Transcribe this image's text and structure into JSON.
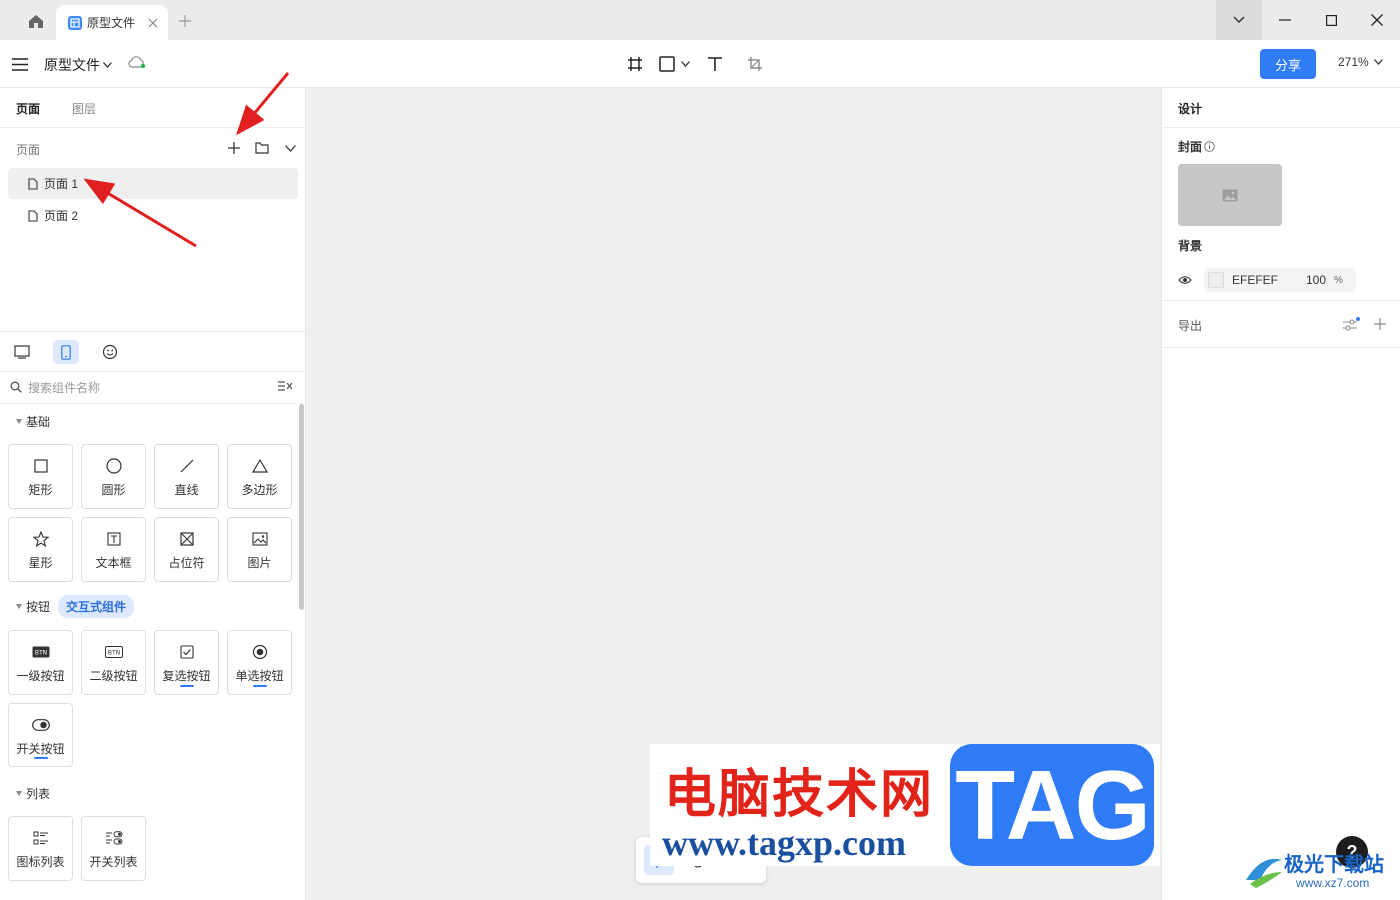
{
  "titlebar": {
    "tab_label": "原型文件"
  },
  "toolbar": {
    "filename": "原型文件",
    "share_label": "分享",
    "zoom": "271%"
  },
  "left_panel": {
    "tabs": [
      "页面",
      "图层"
    ],
    "pages_heading": "页面",
    "pages": [
      "页面 1",
      "页面 2"
    ],
    "selected_page": 0,
    "search_placeholder": "搜索组件名称",
    "sections": {
      "basic": {
        "title": "基础",
        "items": [
          "矩形",
          "圆形",
          "直线",
          "多边形",
          "星形",
          "文本框",
          "占位符",
          "图片"
        ]
      },
      "buttons": {
        "title": "按钮",
        "badge": "交互式组件",
        "items": [
          "一级按钮",
          "二级按钮",
          "复选按钮",
          "单选按钮",
          "开关按钮"
        ]
      },
      "lists": {
        "title": "列表",
        "items": [
          "图标列表",
          "开关列表"
        ]
      }
    }
  },
  "right_panel": {
    "title": "设计",
    "cover_label": "封面",
    "background_label": "背景",
    "background_hex": "EFEFEF",
    "background_opacity": "100",
    "background_opacity_unit": "%",
    "export_label": "导出"
  },
  "watermark": {
    "cn": "电脑技术网",
    "url": "www.tagxp.com",
    "tag": "TAG",
    "site2_title": "极光下载站",
    "site2_url": "www.xz7.com"
  },
  "help_label": "?",
  "colors": {
    "accent": "#2f7cf6",
    "canvas_bg": "#efefef",
    "arrow": "#e02020"
  }
}
